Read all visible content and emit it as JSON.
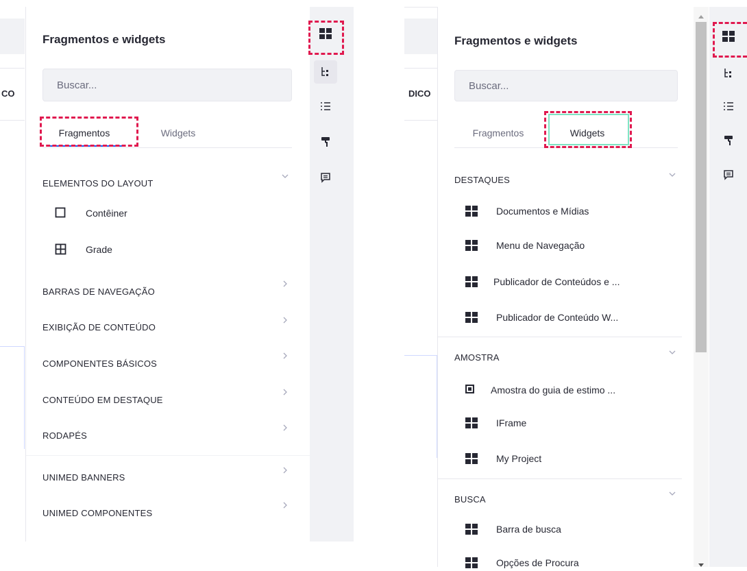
{
  "left": {
    "cut_text": "CO",
    "panel_title": "Fragmentos e widgets",
    "search_placeholder": "Buscar...",
    "tabs": [
      "Fragmentos",
      "Widgets"
    ],
    "active_tab": "Fragmentos",
    "sections": [
      {
        "label": "ELEMENTOS DO LAYOUT",
        "expanded": true,
        "items": [
          {
            "label": "Contêiner",
            "icon": "container-icon"
          },
          {
            "label": "Grade",
            "icon": "grid-icon"
          }
        ]
      },
      {
        "label": "BARRAS DE NAVEGAÇÃO",
        "expanded": false
      },
      {
        "label": "EXIBIÇÃO DE CONTEÚDO",
        "expanded": false
      },
      {
        "label": "COMPONENTES BÁSICOS",
        "expanded": false
      },
      {
        "label": "CONTEÚDO EM DESTAQUE",
        "expanded": false
      },
      {
        "label": "RODAPÉS",
        "expanded": false
      },
      {
        "label": "UNIMED BANNERS",
        "expanded": false
      },
      {
        "label": "UNIMED COMPONENTES",
        "expanded": false
      }
    ]
  },
  "right": {
    "cut_text": "DICO",
    "panel_title": "Fragmentos e widgets",
    "search_placeholder": "Buscar...",
    "tabs": [
      "Fragmentos",
      "Widgets"
    ],
    "active_tab": "Widgets",
    "sections": [
      {
        "label": "DESTAQUES",
        "expanded": true,
        "items": [
          {
            "label": "Documentos e Mídias",
            "icon": "widget-icon"
          },
          {
            "label": "Menu de Navegação",
            "icon": "widget-icon"
          },
          {
            "label": "Publicador de Conteúdos e ...",
            "icon": "widget-icon"
          },
          {
            "label": "Publicador de Conteúdo W...",
            "icon": "widget-icon"
          }
        ]
      },
      {
        "label": "AMOSTRA",
        "expanded": true,
        "items": [
          {
            "label": "Amostra do guia de estimo ...",
            "icon": "square-icon"
          },
          {
            "label": "IFrame",
            "icon": "widget-icon"
          },
          {
            "label": "My Project",
            "icon": "widget-icon"
          }
        ]
      },
      {
        "label": "BUSCA",
        "expanded": true,
        "items": [
          {
            "label": "Barra de busca",
            "icon": "widget-icon"
          },
          {
            "label": "Opções de Procura",
            "icon": "widget-icon"
          }
        ]
      }
    ]
  },
  "rail_icons": [
    "widgets-icon",
    "page-structure-icon",
    "list-icon",
    "paint-roller-icon",
    "comment-icon"
  ],
  "colors": {
    "highlight_dash": "#e0194f",
    "active_tab_underline": "#0b5fff",
    "active_tab_outline": "#7fe3c3"
  }
}
